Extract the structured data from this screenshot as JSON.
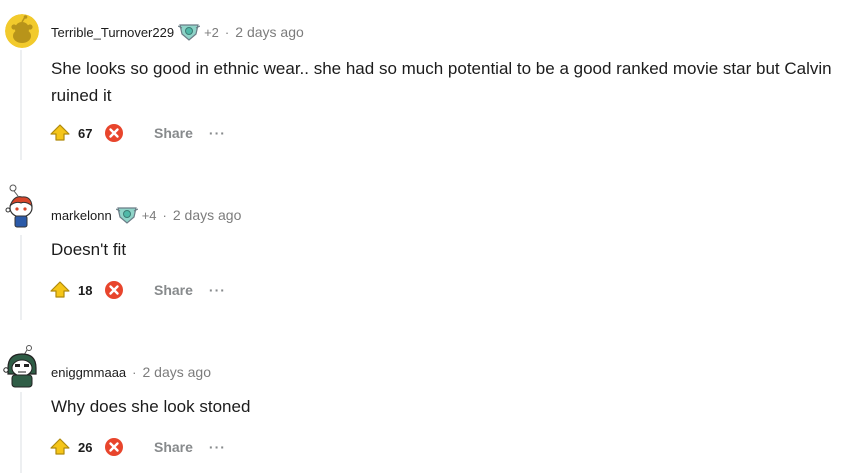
{
  "comments": [
    {
      "author": "Terrible_Turnover229",
      "flair_icon": "award-badge-icon",
      "award_count": "+2",
      "time": "2 days ago",
      "body": "She looks so good in ethnic wear.. she had so much potential to be a good ranked movie star but Calvin ruined it",
      "score": "67",
      "share_label": "Share",
      "more_label": "···",
      "avatar_icon": "yellow-snoo-avatar"
    },
    {
      "author": "markelonn",
      "flair_icon": "award-badge-icon",
      "award_count": "+4",
      "time": "2 days ago",
      "body": "Doesn't fit",
      "score": "18",
      "share_label": "Share",
      "more_label": "···",
      "avatar_icon": "red-hair-snoo-avatar"
    },
    {
      "author": "eniggmmaaa",
      "time": "2 days ago",
      "body": "Why does she look stoned",
      "score": "26",
      "share_label": "Share",
      "more_label": "···",
      "avatar_icon": "green-hood-snoo-avatar"
    }
  ],
  "colors": {
    "upvote": "#f5c518",
    "downvote": "#e8452c",
    "muted": "#7c7c7c",
    "thread_line": "#edeff1"
  }
}
